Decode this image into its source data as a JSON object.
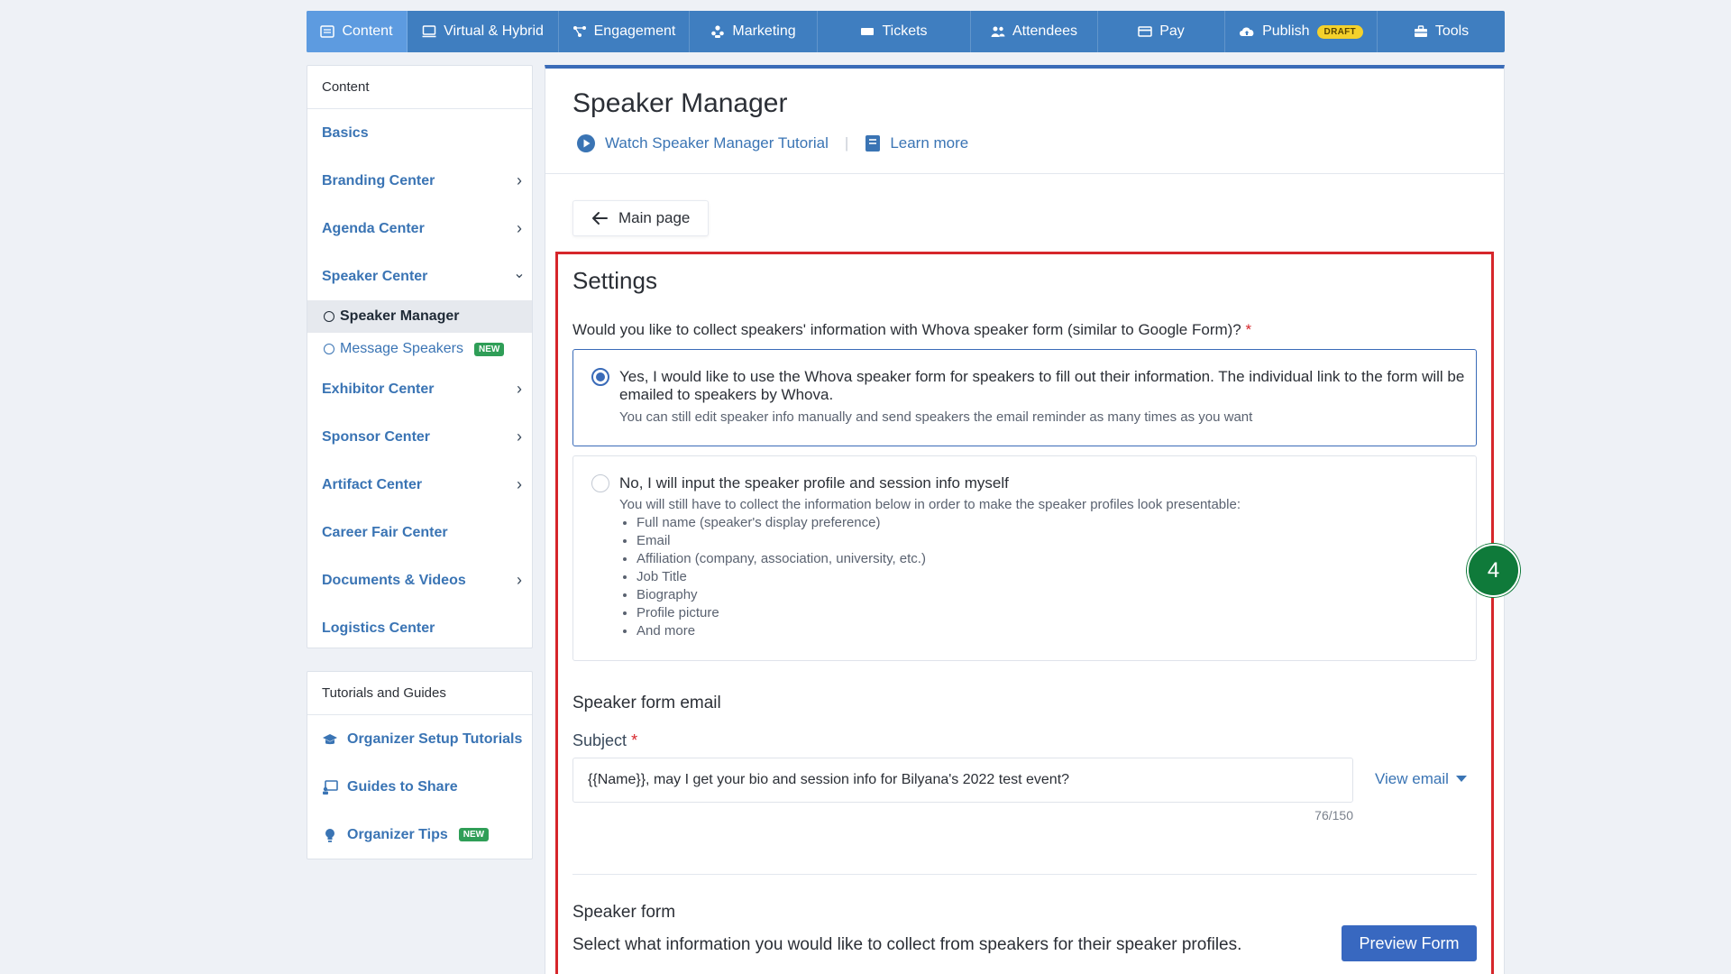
{
  "nav": {
    "tabs": [
      {
        "label": "Content",
        "icon": "content-icon"
      },
      {
        "label": "Virtual & Hybrid",
        "icon": "monitor-icon"
      },
      {
        "label": "Engagement",
        "icon": "network-icon"
      },
      {
        "label": "Marketing",
        "icon": "people-icon"
      },
      {
        "label": "Tickets",
        "icon": "ticket-icon"
      },
      {
        "label": "Attendees",
        "icon": "attendees-icon"
      },
      {
        "label": "Pay",
        "icon": "card-icon"
      },
      {
        "label": "Publish",
        "icon": "cloud-upload-icon",
        "badge": "DRAFT"
      },
      {
        "label": "Tools",
        "icon": "toolbox-icon"
      }
    ],
    "active_color": "#5d9be0",
    "bar_color": "#3f7ec0"
  },
  "sidebar": {
    "header": "Content",
    "items": [
      {
        "label": "Basics",
        "chevron": ""
      },
      {
        "label": "Branding Center",
        "chevron": "›"
      },
      {
        "label": "Agenda Center",
        "chevron": "›"
      },
      {
        "label": "Speaker Center",
        "chevron": "⌄"
      },
      {
        "label": "Exhibitor Center",
        "chevron": "›"
      },
      {
        "label": "Sponsor Center",
        "chevron": "›"
      },
      {
        "label": "Artifact Center",
        "chevron": "›"
      },
      {
        "label": "Career Fair Center",
        "chevron": ""
      },
      {
        "label": "Documents & Videos",
        "chevron": "›"
      },
      {
        "label": "Logistics Center",
        "chevron": ""
      }
    ],
    "sub_items": [
      {
        "label": "Speaker Manager"
      },
      {
        "label": "Message Speakers",
        "badge": "NEW"
      }
    ]
  },
  "tutorials": {
    "header": "Tutorials and Guides",
    "items": [
      {
        "label": "Organizer Setup Tutorials",
        "icon": "graduation-cap-icon"
      },
      {
        "label": "Guides to Share",
        "icon": "presentation-icon"
      },
      {
        "label": "Organizer Tips",
        "icon": "lightbulb-icon",
        "badge": "NEW"
      }
    ]
  },
  "main": {
    "title": "Speaker Manager",
    "tutorial_link": "Watch Speaker Manager Tutorial",
    "learn_more": "Learn more",
    "back_button": "Main page",
    "step_number": "4",
    "settings": {
      "title": "Settings",
      "question": "Would you like to collect speakers' information with Whova speaker form (similar to Google Form)?",
      "required_mark": "*",
      "option_yes": {
        "label": "Yes, I would like to use the Whova speaker form for speakers to fill out their information. The individual link to the form will be emailed to speakers by Whova.",
        "note": "You can still edit speaker info manually and send speakers the email reminder as many times as you want"
      },
      "option_no": {
        "label": "No, I will input the speaker profile and session info myself",
        "note": "You will still have to collect the information below in order to make the speaker profiles look presentable:",
        "list": [
          "Full name (speaker's display preference)",
          "Email",
          "Affiliation (company, association, university, etc.)",
          "Job Title",
          "Biography",
          "Profile picture",
          "And more"
        ]
      }
    },
    "email": {
      "section_title": "Speaker form email",
      "subject_label": "Subject",
      "subject_value": "{{Name}}, may I get your bio and session info for Bilyana's 2022 test event?",
      "counter": "76/150",
      "view_email": "View email"
    },
    "form": {
      "section_title": "Speaker form",
      "description": "Select what information you would like to collect from speakers for their speaker profiles.",
      "preview_button": "Preview Form"
    }
  }
}
